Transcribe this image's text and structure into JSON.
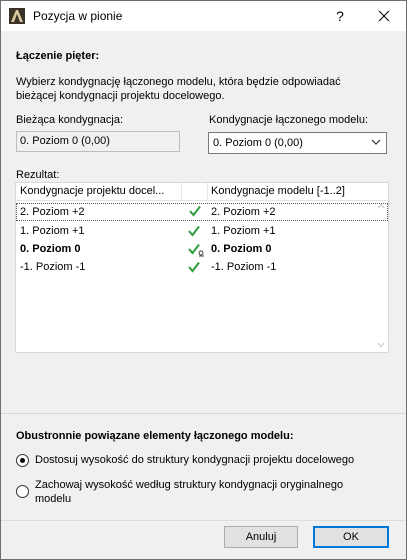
{
  "window": {
    "title": "Pozycja w pionie",
    "help_label": "?"
  },
  "section_join": {
    "title": "Łączenie pięter:",
    "description_line1": "Wybierz kondygnację łączonego modelu, która będzie odpowiadać",
    "description_line2": "bieżącej kondygnacji projektu docelowego."
  },
  "current_story": {
    "label": "Bieżąca kondygnacja:",
    "value": "0. Poziom 0 (0,00)"
  },
  "merged_story": {
    "label": "Kondygnacje łączonego modelu:",
    "selected": "0. Poziom 0 (0,00)"
  },
  "result": {
    "label": "Rezultat:",
    "columns": [
      "Kondygnacje projektu docel...",
      "Kondygnacje modelu [-1..2]"
    ],
    "rows": [
      {
        "target": "2. Poziom +2",
        "model": "2. Poziom +2",
        "selected": true,
        "bold": false
      },
      {
        "target": "1. Poziom +1",
        "model": "1. Poziom +1",
        "selected": false,
        "bold": false
      },
      {
        "target": "0. Poziom 0",
        "model": "0. Poziom 0",
        "selected": false,
        "bold": true
      },
      {
        "target": "-1. Poziom -1",
        "model": "-1. Poziom -1",
        "selected": false,
        "bold": false
      }
    ]
  },
  "linked_elements": {
    "title": "Obustronnie powiązane elementy łączonego modelu:",
    "option1": "Dostosuj wysokość do struktury kondygnacji projektu docelowego",
    "option2_line1": "Zachowaj wysokość według struktury kondygnacji oryginalnego",
    "option2_line2": "modelu",
    "selected_option": 1
  },
  "buttons": {
    "cancel": "Anuluj",
    "ok": "OK"
  },
  "colors": {
    "check_green": "#2e9e3e",
    "primary_border": "#0078d7"
  }
}
